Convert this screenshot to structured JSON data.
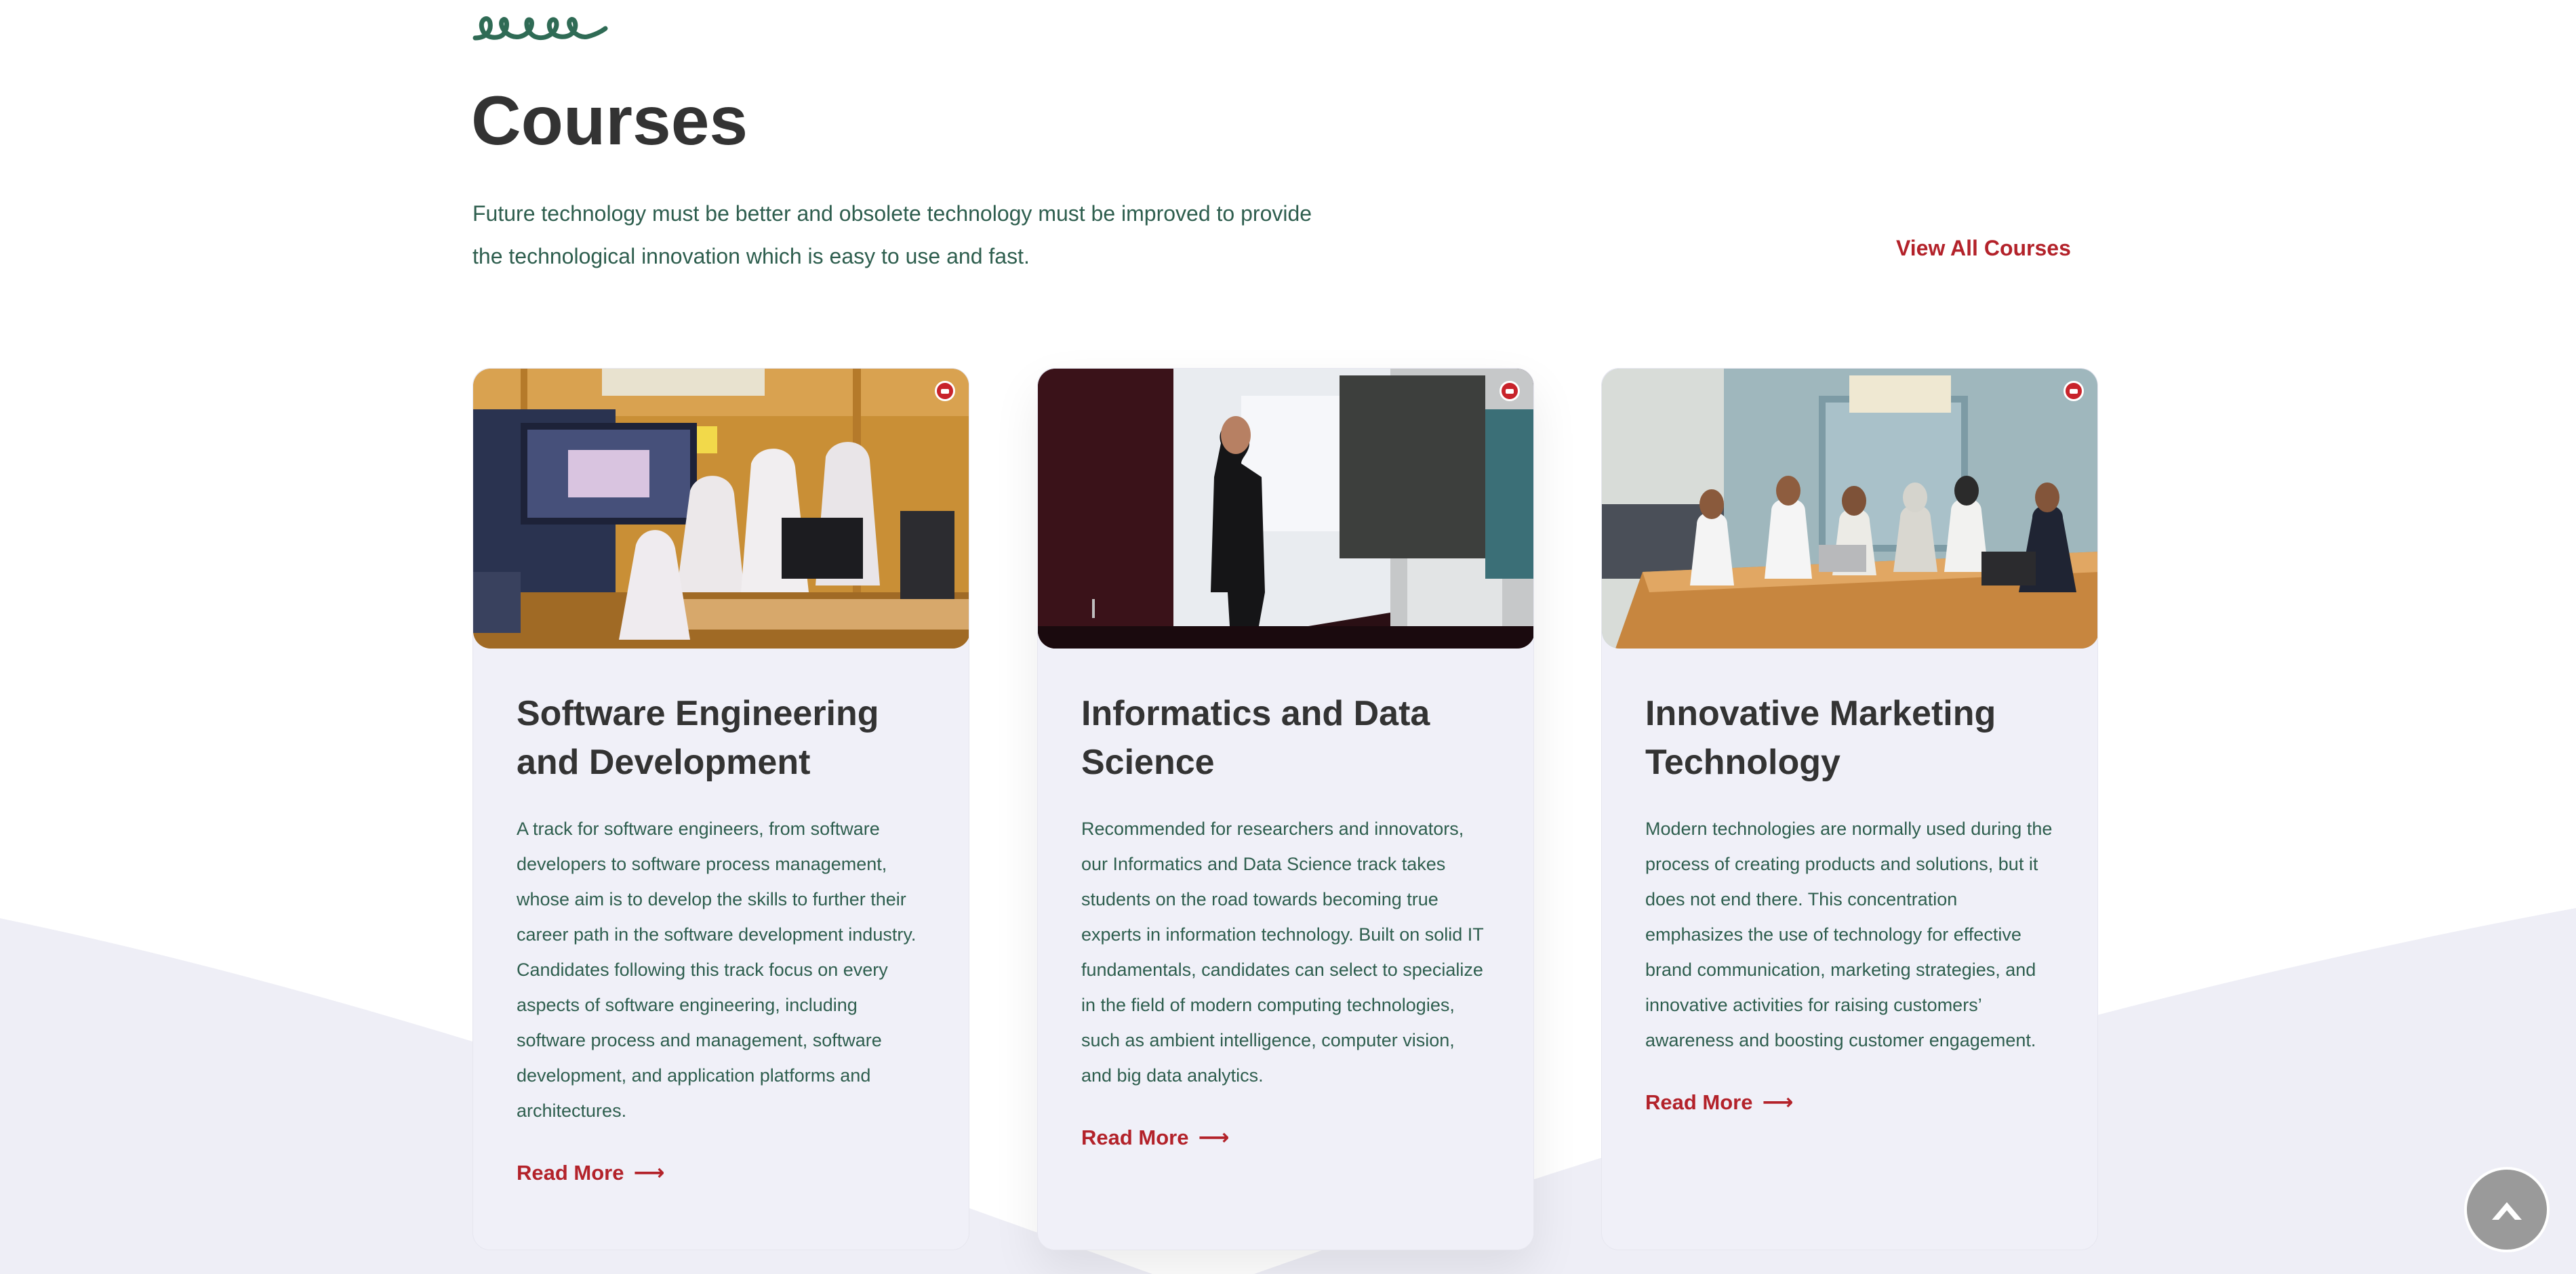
{
  "section": {
    "title": "Courses",
    "description": "Future technology must be better and obsolete technology must be improved to provide the technological innovation which is easy to use and fast.",
    "view_all_label": "View All Courses"
  },
  "cards": [
    {
      "title": "Software Engineering and Development",
      "text": "A track for software engineers, from software developers to software process management, whose aim is to develop the skills to further their career path in the software development industry. Candidates following this track focus on every aspects of software engineering, including software process and management, software development, and application platforms and architectures.",
      "read_more": "Read More"
    },
    {
      "title": "Informatics and Data Science",
      "text": "Recommended for researchers and innovators, our Informatics and Data Science track takes students on the road towards becoming true experts in information technology. Built on solid IT fundamentals, candidates can select to specialize in the field of modern computing technologies, such as ambient intelligence, computer vision, and big data analytics.",
      "read_more": "Read More"
    },
    {
      "title": "Innovative Marketing Technology",
      "text": "Modern technologies are normally used during the process of creating products and solutions, but it does not end there. This concentration emphasizes the use of technology for effective brand communication, marketing strategies, and innovative activities for raising customers’ awareness and boosting customer engagement.",
      "read_more": "Read More"
    }
  ],
  "colors": {
    "accent": "#b3222a",
    "text_green": "#2e5e4e",
    "heading": "#333333",
    "card_bg": "#f0f0f8",
    "wave_bg": "#eeeef6"
  },
  "icons": {
    "decoration": "squiggle-decoration",
    "card_badge": "university-logo-icon",
    "read_more": "arrow-right-icon",
    "scroll_top": "chevron-up-icon"
  }
}
